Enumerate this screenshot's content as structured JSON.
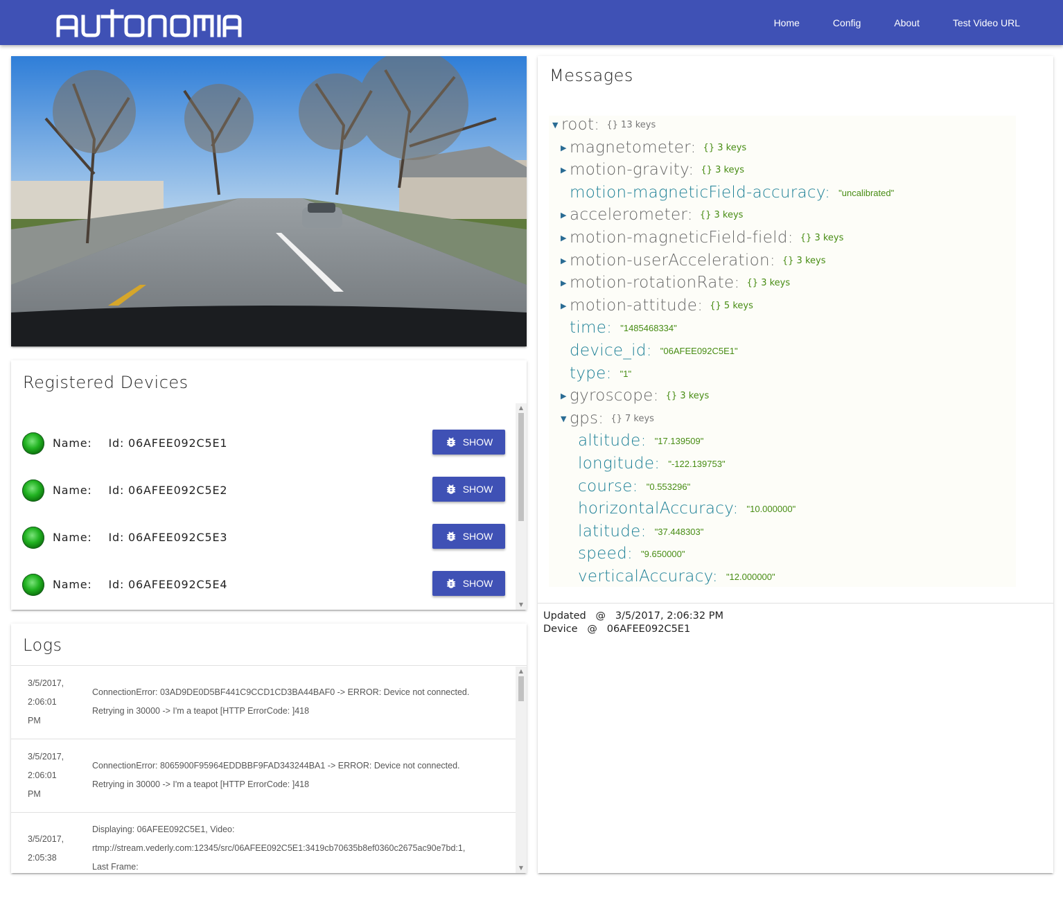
{
  "app": {
    "brand": "AUTONOMIA"
  },
  "nav": [
    {
      "label": "Home"
    },
    {
      "label": "Config"
    },
    {
      "label": "About"
    },
    {
      "label": "Test Video URL"
    }
  ],
  "devices": {
    "title": "Registered Devices",
    "name_label": "Name:",
    "id_prefix": "Id:",
    "show_label": "SHOW",
    "items": [
      {
        "id": "06AFEE092C5E1"
      },
      {
        "id": "06AFEE092C5E2"
      },
      {
        "id": "06AFEE092C5E3"
      },
      {
        "id": "06AFEE092C5E4"
      }
    ]
  },
  "logs": {
    "title": "Logs",
    "items": [
      {
        "date": [
          "3/5/2017,",
          "2:06:01",
          "PM"
        ],
        "message": [
          "ConnectionError: 03AD9DE0D5BF441C9CCD1CD3BA44BAF0 -> ERROR: Device not connected.",
          "Retrying in 30000 -> I'm a teapot [HTTP ErrorCode: ]418"
        ]
      },
      {
        "date": [
          "3/5/2017,",
          "2:06:01",
          "PM"
        ],
        "message": [
          "ConnectionError: 8065900F95964EDDBBF9FAD343244BA1 -> ERROR: Device not connected.",
          "Retrying in 30000 -> I'm a teapot [HTTP ErrorCode: ]418"
        ]
      },
      {
        "date": [
          "3/5/2017,",
          "2:05:38"
        ],
        "message": [
          "Displaying: 06AFEE092C5E1, Video:",
          "rtmp://stream.vederly.com:12345/src/06AFEE092C5E1:3419cb70635b8ef0360c2675ac90e7bd:1,",
          "Last Frame:"
        ]
      }
    ]
  },
  "messages": {
    "title": "Messages",
    "tree": [
      {
        "depth": 0,
        "arrow": "down",
        "key": "root:",
        "kind": "obj",
        "meta": "{} 13 keys",
        "meta_color": "gray"
      },
      {
        "depth": 1,
        "arrow": "right",
        "key": "magnetometer:",
        "kind": "obj",
        "meta": "{} 3 keys"
      },
      {
        "depth": 1,
        "arrow": "right",
        "key": "motion-gravity:",
        "kind": "obj",
        "meta": "{} 3 keys"
      },
      {
        "depth": 1,
        "arrow": "",
        "key": "motion-magneticField-accuracy:",
        "kind": "val",
        "value": "\"uncalibrated\""
      },
      {
        "depth": 1,
        "arrow": "right",
        "key": "accelerometer:",
        "kind": "obj",
        "meta": "{} 3 keys"
      },
      {
        "depth": 1,
        "arrow": "right",
        "key": "motion-magneticField-field:",
        "kind": "obj",
        "meta": "{} 3 keys"
      },
      {
        "depth": 1,
        "arrow": "right",
        "key": "motion-userAcceleration:",
        "kind": "obj",
        "meta": "{} 3 keys"
      },
      {
        "depth": 1,
        "arrow": "right",
        "key": "motion-rotationRate:",
        "kind": "obj",
        "meta": "{} 3 keys"
      },
      {
        "depth": 1,
        "arrow": "right",
        "key": "motion-attitude:",
        "kind": "obj",
        "meta": "{} 5 keys"
      },
      {
        "depth": 1,
        "arrow": "",
        "key": "time:",
        "kind": "val",
        "value": "\"1485468334\""
      },
      {
        "depth": 1,
        "arrow": "",
        "key": "device_id:",
        "kind": "val",
        "value": "\"06AFEE092C5E1\""
      },
      {
        "depth": 1,
        "arrow": "",
        "key": "type:",
        "kind": "val",
        "value": "\"1\""
      },
      {
        "depth": 1,
        "arrow": "right",
        "key": "gyroscope:",
        "kind": "obj",
        "meta": "{} 3 keys"
      },
      {
        "depth": 1,
        "arrow": "down",
        "key": "gps:",
        "kind": "obj",
        "meta": "{} 7 keys",
        "meta_color": "gray"
      },
      {
        "depth": 2,
        "arrow": "",
        "key": "altitude:",
        "kind": "val",
        "value": "\"17.139509\""
      },
      {
        "depth": 2,
        "arrow": "",
        "key": "longitude:",
        "kind": "val",
        "value": "\"-122.139753\""
      },
      {
        "depth": 2,
        "arrow": "",
        "key": "course:",
        "kind": "val",
        "value": "\"0.553296\""
      },
      {
        "depth": 2,
        "arrow": "",
        "key": "horizontalAccuracy:",
        "kind": "val",
        "value": "\"10.000000\""
      },
      {
        "depth": 2,
        "arrow": "",
        "key": "latitude:",
        "kind": "val",
        "value": "\"37.448303\""
      },
      {
        "depth": 2,
        "arrow": "",
        "key": "speed:",
        "kind": "val",
        "value": "\"9.650000\""
      },
      {
        "depth": 2,
        "arrow": "",
        "key": "verticalAccuracy:",
        "kind": "val",
        "value": "\"12.000000\""
      }
    ],
    "footer": {
      "updated_label": "Updated",
      "updated_value": "3/5/2017, 2:06:32 PM",
      "device_label": "Device",
      "device_value": "06AFEE092C5E1",
      "at": "@"
    }
  }
}
